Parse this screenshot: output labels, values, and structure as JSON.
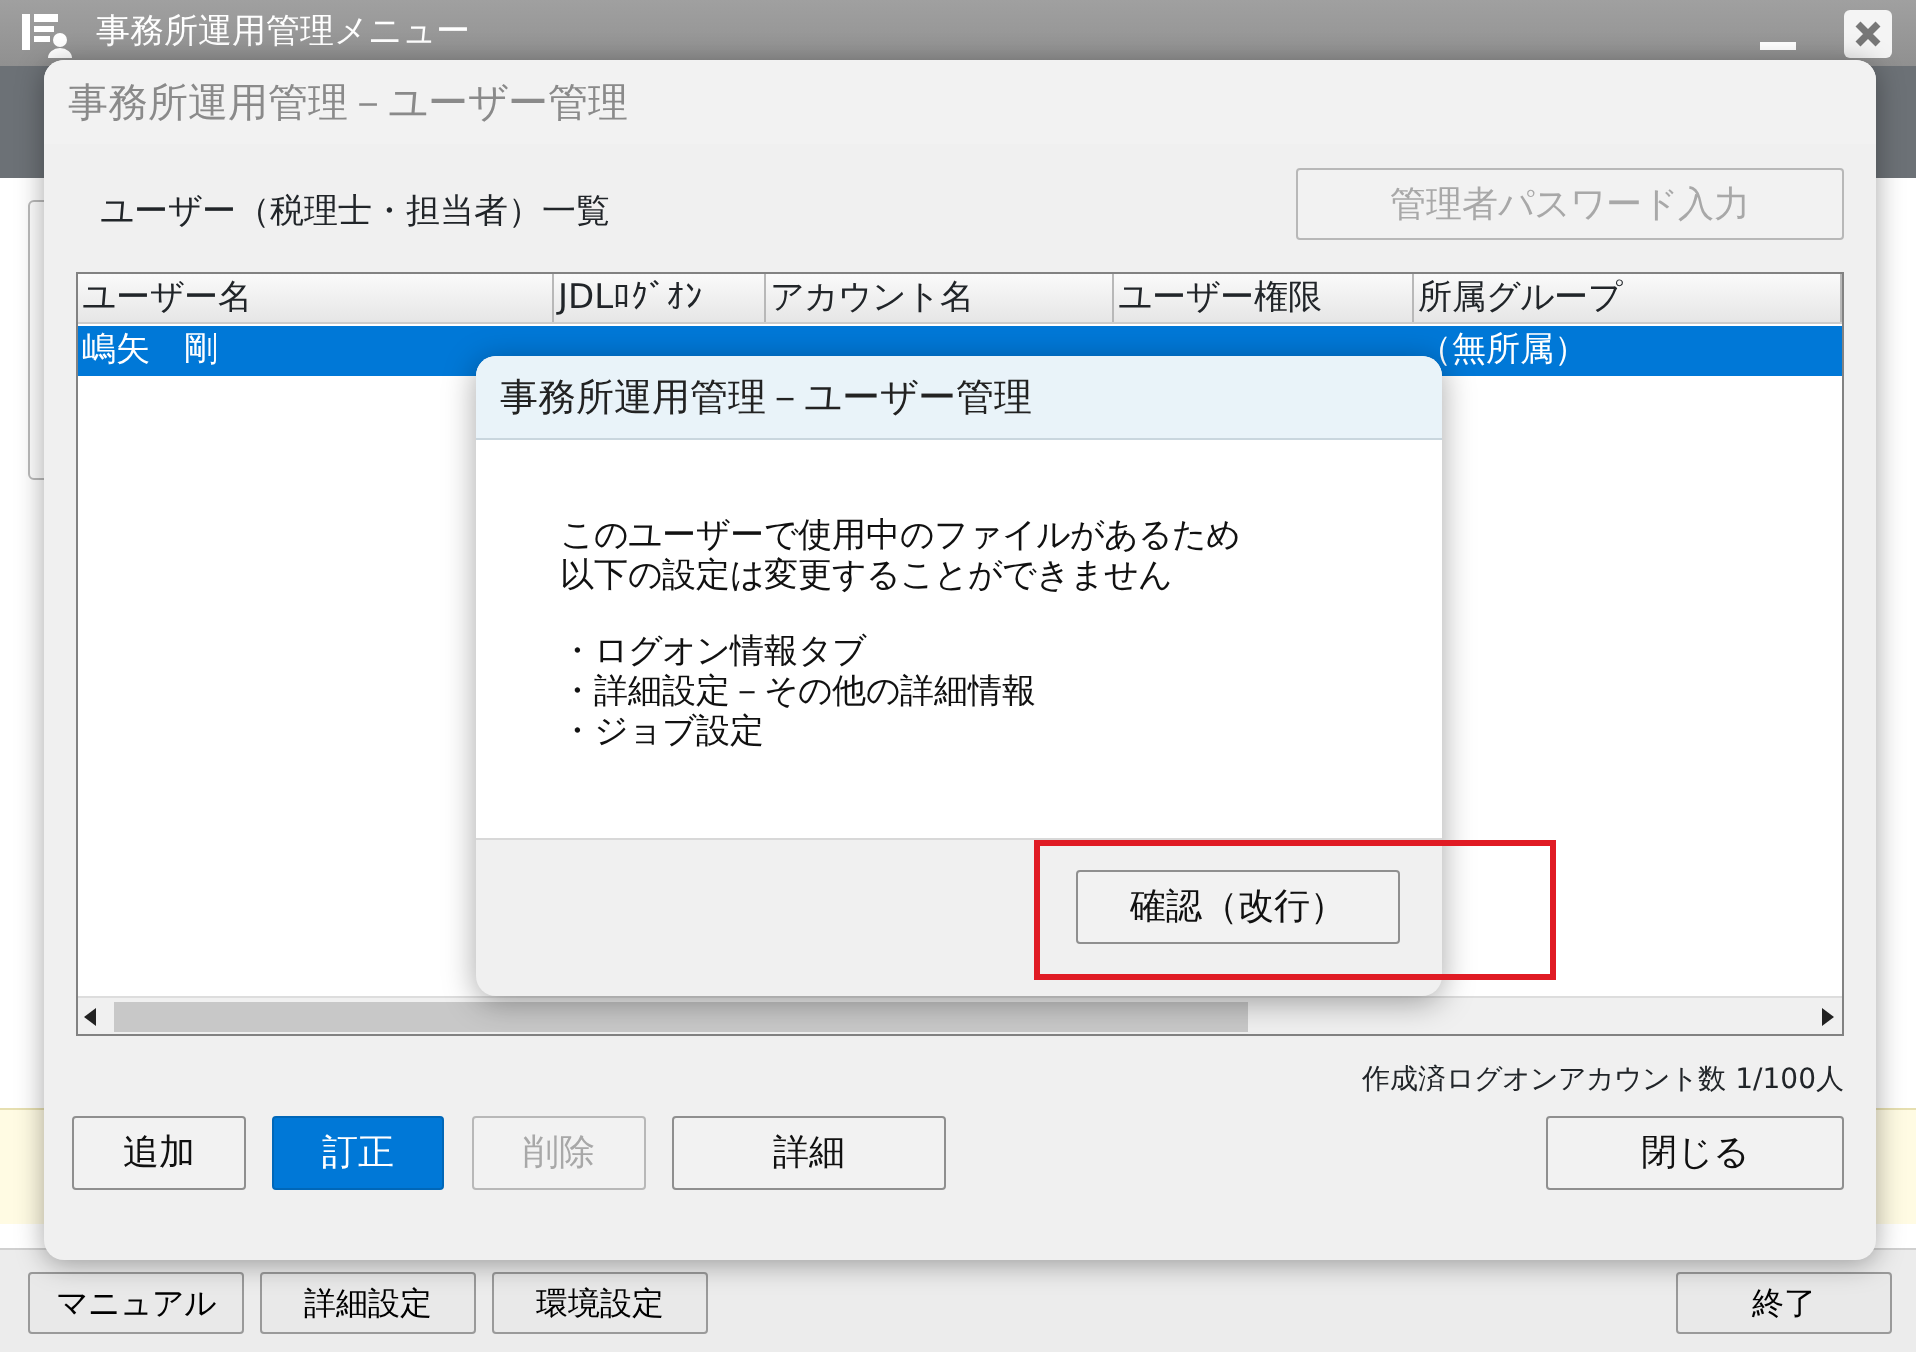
{
  "app_window": {
    "title": "事務所運用管理メニュー",
    "footer_buttons": [
      {
        "label": "マニュアル"
      },
      {
        "label": "詳細設定"
      },
      {
        "label": "環境設定"
      },
      {
        "label": "終了"
      }
    ]
  },
  "user_window": {
    "title": "事務所運用管理－ユーザー管理",
    "list_label": "ユーザー（税理士・担当者）一覧",
    "password_button": {
      "label": "管理者パスワード入力",
      "disabled": true
    },
    "table": {
      "columns": [
        "ユーザー名",
        "JDLﾛｸﾞｵﾝ",
        "アカウント名",
        "ユーザー権限",
        "所属グループ"
      ],
      "rows": [
        {
          "cells": [
            "嶋矢　剛",
            null,
            null,
            null,
            "（無所属）"
          ],
          "selected": true
        }
      ]
    },
    "account_count": "作成済ログオンアカウント数 1/100人",
    "buttons": [
      {
        "label": "追加",
        "selected": false,
        "disabled": false
      },
      {
        "label": "訂正",
        "selected": true,
        "disabled": false
      },
      {
        "label": "削除",
        "selected": false,
        "disabled": true
      },
      {
        "label": "詳細",
        "selected": false,
        "disabled": false
      }
    ],
    "close_button": "閉じる"
  },
  "dialog": {
    "title": "事務所運用管理－ユーザー管理",
    "message": [
      "このユーザーで使用中のファイルがあるため",
      "以下の設定は変更することができません"
    ],
    "items": [
      "・ログオン情報タブ",
      "・詳細設定－その他の詳細情報",
      "・ジョブ設定"
    ],
    "confirm_button": "確認（改行）",
    "highlighted": true
  }
}
